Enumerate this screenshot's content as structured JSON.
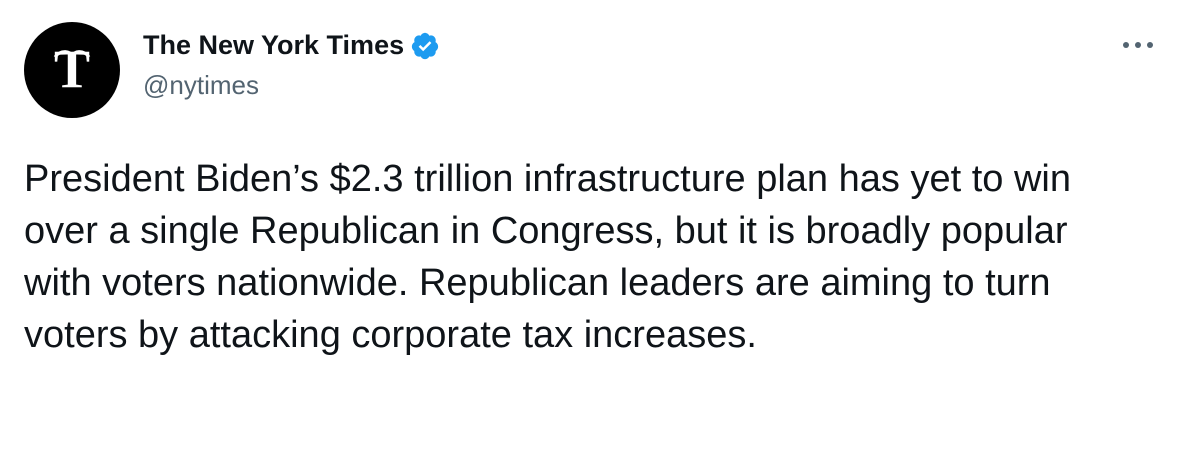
{
  "author": {
    "display_name": "The New York Times",
    "handle": "@nytimes",
    "verified": true,
    "avatar_icon": "nyt-logo-icon"
  },
  "menu": {
    "icon": "more-options-icon"
  },
  "tweet": {
    "text": "President Biden’s $2.3 trillion infrastructure plan has yet to win over a single Republican in Congress, but it is broadly popular with voters nationwide. Republican leaders are aiming to turn voters by attacking corporate tax increases."
  },
  "colors": {
    "text": "#0f1419",
    "secondary": "#536471",
    "verified_badge": "#1d9bf0",
    "avatar_bg": "#000000"
  }
}
